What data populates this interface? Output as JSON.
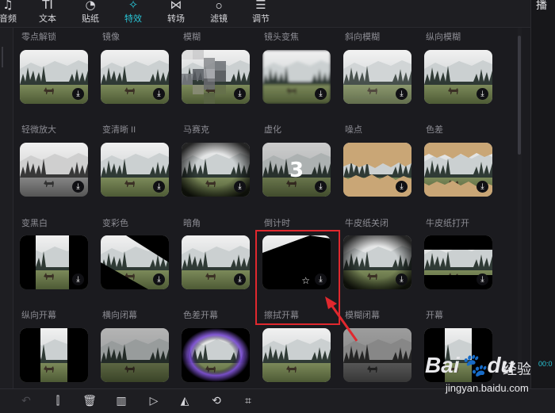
{
  "toolbar": {
    "items": [
      {
        "label": "音频",
        "icon": "music-note-icon",
        "glyph": "♫"
      },
      {
        "label": "文本",
        "icon": "text-icon",
        "glyph": "TI"
      },
      {
        "label": "贴纸",
        "icon": "sticker-icon",
        "glyph": "◔"
      },
      {
        "label": "特效",
        "icon": "sparkle-icon",
        "glyph": "✧"
      },
      {
        "label": "转场",
        "icon": "transition-icon",
        "glyph": "⋈"
      },
      {
        "label": "滤镜",
        "icon": "filter-icon",
        "glyph": "ဝ"
      },
      {
        "label": "调节",
        "icon": "sliders-icon",
        "glyph": "☰"
      }
    ],
    "active": "特效"
  },
  "right_panel": {
    "title": "播",
    "time": "00:0"
  },
  "effects": {
    "row0": [
      "零点解锁",
      "镜像",
      "模糊",
      "镜头变焦",
      "斜向模糊",
      "纵向模糊"
    ],
    "row1": [
      "轻微放大",
      "变清晰 II",
      "马赛克",
      "虚化",
      "噪点",
      "色差"
    ],
    "row2": [
      "变黑白",
      "变彩色",
      "暗角",
      "倒计时",
      "牛皮纸关闭",
      "牛皮纸打开"
    ],
    "row3": [
      "纵向开幕",
      "横向闭幕",
      "色差开幕",
      "擦拭开幕",
      "模糊闭幕",
      "开幕"
    ],
    "countdown_digit": "3",
    "selected": "擦拭开幕"
  },
  "bottom_toolbar": {
    "icons": [
      "undo-icon",
      "split-icon",
      "delete-icon",
      "freeze-frame-icon",
      "play-icon",
      "mirror-icon",
      "rotate-icon",
      "crop-icon"
    ]
  },
  "watermark": {
    "brand": "Bai",
    "brand2": "du",
    "cn": "经验",
    "url": "jingyan.baidu.com"
  }
}
